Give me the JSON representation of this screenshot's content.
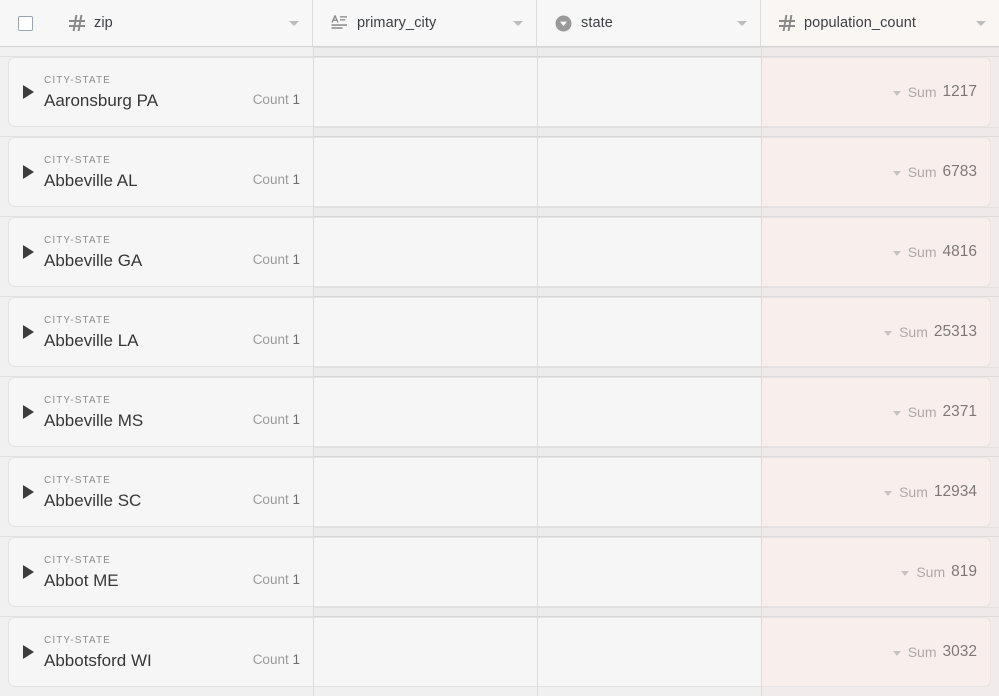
{
  "header": {
    "select_all_checkbox": "checkbox-unchecked",
    "columns": [
      {
        "label": "zip",
        "icon": "hash-icon",
        "type": "number",
        "caret": true
      },
      {
        "label": "primary_city",
        "icon": "text-icon",
        "type": "text",
        "caret": true
      },
      {
        "label": "state",
        "icon": "single-select-icon",
        "type": "select",
        "caret": true
      },
      {
        "label": "population_count",
        "icon": "hash-icon",
        "type": "number",
        "caret": true
      }
    ]
  },
  "group_field_label": "CITY-STATE",
  "count_label": "Count",
  "sum_label": "Sum",
  "rows": [
    {
      "group_value": "Aaronsburg PA",
      "count": "1",
      "sum": "1217"
    },
    {
      "group_value": "Abbeville AL",
      "count": "1",
      "sum": "6783"
    },
    {
      "group_value": "Abbeville GA",
      "count": "1",
      "sum": "4816"
    },
    {
      "group_value": "Abbeville LA",
      "count": "1",
      "sum": "25313"
    },
    {
      "group_value": "Abbeville MS",
      "count": "1",
      "sum": "2371"
    },
    {
      "group_value": "Abbeville SC",
      "count": "1",
      "sum": "12934"
    },
    {
      "group_value": "Abbot ME",
      "count": "1",
      "sum": "819"
    },
    {
      "group_value": "Abbotsford WI",
      "count": "1",
      "sum": "3032"
    }
  ],
  "colors": {
    "surface": "#f7f6f6",
    "page_background": "#f0f0f0",
    "header_background": "#f7f7f7",
    "number_column_tint": "#faf4f2",
    "border": "#dcdcdc",
    "text_primary": "#373737",
    "text_muted": "#8d8d8d"
  }
}
